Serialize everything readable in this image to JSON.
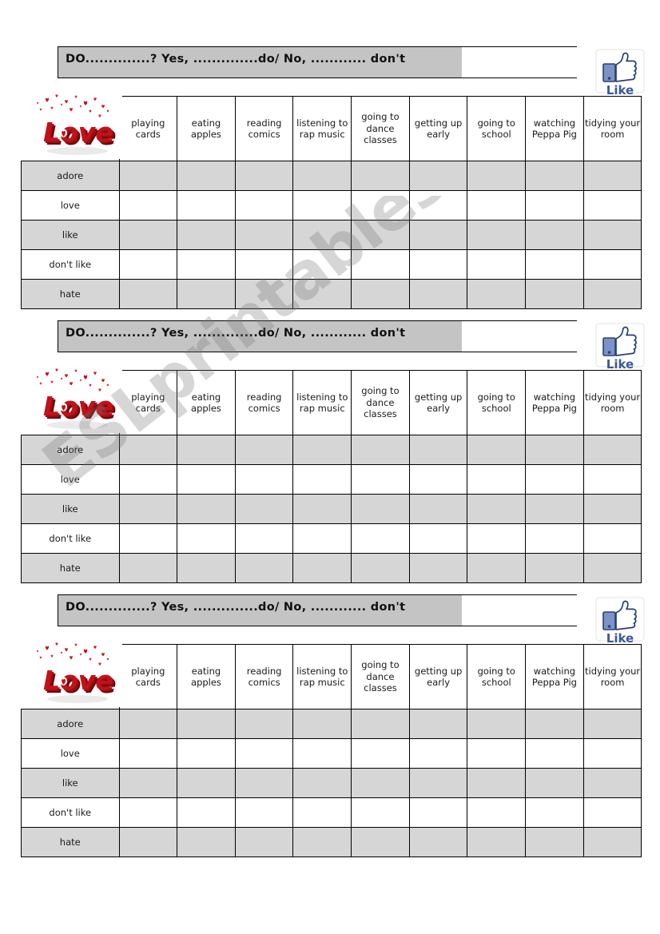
{
  "document": {
    "type": "esl-worksheet",
    "watermark": "ESLprintables.com",
    "blocks": 3
  },
  "banner": {
    "text": "DO..............?   Yes, ..............do/ No, ............ don't",
    "highlight_color": "#c4c4c4"
  },
  "like_badge": {
    "label": "Like",
    "icon": "thumbs-up-icon",
    "brand_color": "#3b5998"
  },
  "logo": {
    "text": "Love",
    "icon": "love-3d-hearts-image",
    "color": "#c1121a"
  },
  "table": {
    "column_headers": [
      "playing cards",
      "eating apples",
      "reading comics",
      "listening to rap music",
      "going to dance classes",
      "getting up early",
      "going to school",
      "watching Peppa Pig",
      "tidying your room"
    ],
    "row_labels": [
      "adore",
      "love",
      "like",
      "don't like",
      "hate"
    ],
    "shaded_rows": [
      0,
      2,
      4
    ],
    "shade_color": "#d6d6d6"
  }
}
